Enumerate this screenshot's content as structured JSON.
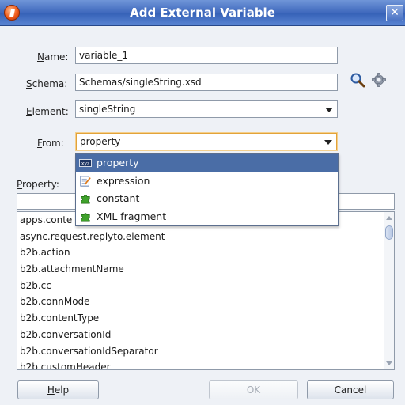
{
  "dialog": {
    "title": "Add External Variable",
    "close_symbol": "✕"
  },
  "form": {
    "name_label_mnemonic": "N",
    "name_label_rest": "ame:",
    "name_value": "variable_1",
    "schema_label_mnemonic": "S",
    "schema_label_rest": "chema:",
    "schema_value": "Schemas/singleString.xsd",
    "element_label_mnemonic": "E",
    "element_label_rest": "lement:",
    "element_value": "singleString",
    "from_label_mnemonic": "F",
    "from_label_rest": "rom:",
    "from_value": "property",
    "property_label_mnemonic": "P",
    "property_label_rest": "roperty:"
  },
  "from_options": [
    {
      "label": "property",
      "icon": "xyz-icon",
      "selected": true
    },
    {
      "label": "expression",
      "icon": "expression-icon",
      "selected": false
    },
    {
      "label": "constant",
      "icon": "puzzle-icon",
      "selected": false
    },
    {
      "label": "XML fragment",
      "icon": "puzzle-icon",
      "selected": false
    }
  ],
  "property_filter_value": "",
  "property_items": [
    "apps.conte",
    "async.request.replyto.element",
    "b2b.action",
    "b2b.attachmentName",
    "b2b.cc",
    "b2b.connMode",
    "b2b.contentType",
    "b2b.conversationId",
    "b2b.conversationIdSeparator",
    "b2b.customHeader"
  ],
  "buttons": {
    "help_mnemonic": "H",
    "help_rest": "elp",
    "ok": "OK",
    "cancel": "Cancel"
  },
  "colors": {
    "titlebar": "#3f69bd",
    "selection": "#4a6da6",
    "focus_border": "#e2a33a"
  }
}
